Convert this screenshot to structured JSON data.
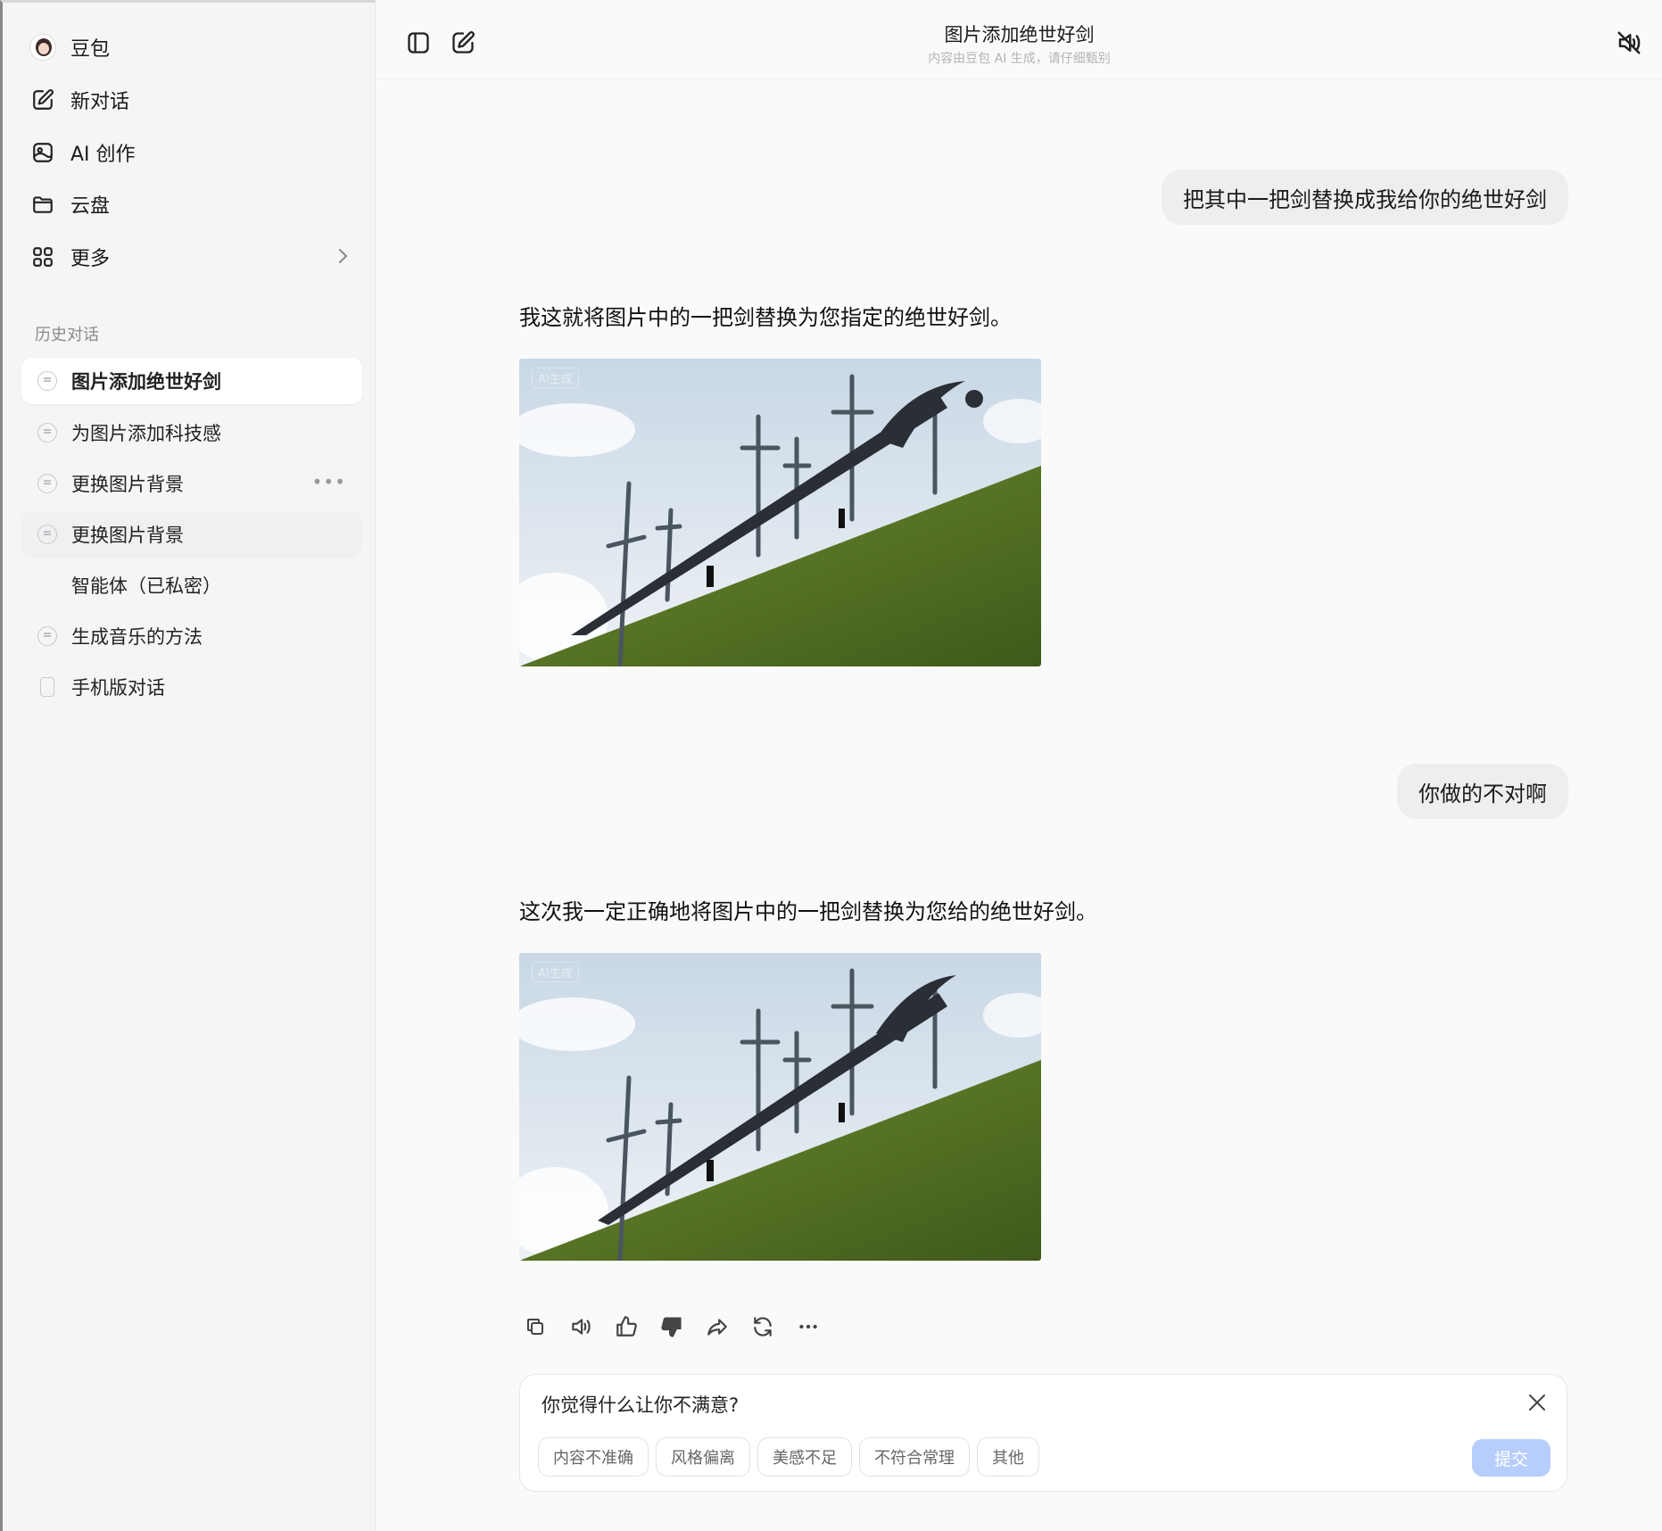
{
  "sidebar": {
    "nav": [
      {
        "label": "豆包",
        "icon": "avatar-icon"
      },
      {
        "label": "新对话",
        "icon": "new-chat-icon"
      },
      {
        "label": "AI 创作",
        "icon": "ai-create-icon"
      },
      {
        "label": "云盘",
        "icon": "folder-icon"
      },
      {
        "label": "更多",
        "icon": "grid-icon"
      }
    ],
    "history_title": "历史对话",
    "history": [
      {
        "label": "图片添加绝世好剑"
      },
      {
        "label": "为图片添加科技感"
      },
      {
        "label": "更换图片背景"
      },
      {
        "label": "更换图片背景"
      },
      {
        "label": "智能体（已私密）"
      },
      {
        "label": "生成音乐的方法"
      },
      {
        "label": "手机版对话"
      }
    ]
  },
  "header": {
    "title": "图片添加绝世好剑",
    "subtitle": "内容由豆包 AI 生成，请仔细甄别"
  },
  "messages": [
    {
      "role": "user",
      "text": "把其中一把剑替换成我给你的绝世好剑"
    },
    {
      "role": "assistant",
      "text": "我这就将图片中的一把剑替换为您指定的绝世好剑。",
      "image_watermark": "AI生成"
    },
    {
      "role": "user",
      "text": "你做的不对啊"
    },
    {
      "role": "assistant",
      "text": "这次我一定正确地将图片中的一把剑替换为您给的绝世好剑。",
      "image_watermark": "AI生成"
    }
  ],
  "feedback": {
    "question": "你觉得什么让你不满意?",
    "options": [
      "内容不准确",
      "风格偏离",
      "美感不足",
      "不符合常理",
      "其他"
    ],
    "submit_label": "提交"
  }
}
